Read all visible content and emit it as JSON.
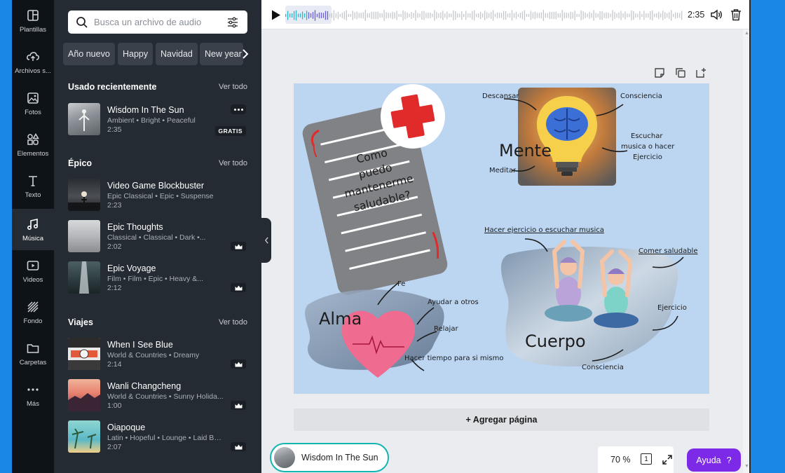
{
  "rail": {
    "items": [
      {
        "label": "Plantillas",
        "icon": "templates-icon"
      },
      {
        "label": "Archivos s...",
        "icon": "upload-cloud-icon"
      },
      {
        "label": "Fotos",
        "icon": "photo-icon"
      },
      {
        "label": "Elementos",
        "icon": "elements-icon"
      },
      {
        "label": "Texto",
        "icon": "text-icon"
      },
      {
        "label": "Música",
        "icon": "music-note-icon",
        "active": true
      },
      {
        "label": "Videos",
        "icon": "video-icon"
      },
      {
        "label": "Fondo",
        "icon": "background-pattern-icon"
      },
      {
        "label": "Carpetas",
        "icon": "folder-icon"
      },
      {
        "label": "Más",
        "icon": "more-dots-icon"
      }
    ]
  },
  "panel": {
    "search_placeholder": "Busca un archivo de audio",
    "chips": [
      "Año nuevo",
      "Happy",
      "Navidad",
      "New year"
    ],
    "sections": [
      {
        "title": "Usado recientemente",
        "link": "Ver todo",
        "tracks": [
          {
            "title": "Wisdom In The Sun",
            "meta": "Ambient • Bright • Peaceful",
            "duration": "2:35",
            "badge": "GRATIS",
            "has_more": true
          }
        ]
      },
      {
        "title": "Épico",
        "link": "Ver todo",
        "tracks": [
          {
            "title": "Video Game Blockbuster",
            "meta": "Epic Classical • Epic • Suspense",
            "duration": "2:23"
          },
          {
            "title": "Epic Thoughts",
            "meta": "Classical • Classical • Dark •...",
            "duration": "2:02",
            "premium": true
          },
          {
            "title": "Epic Voyage",
            "meta": "Film • Film • Epic • Heavy &...",
            "duration": "2:12",
            "premium": true
          }
        ]
      },
      {
        "title": "Viajes",
        "link": "Ver todo",
        "tracks": [
          {
            "title": "When I See Blue",
            "meta": "World & Countries • Dreamy",
            "duration": "2:14",
            "premium": true
          },
          {
            "title": "Wanli Changcheng",
            "meta": "World & Countries • Sunny Holida...",
            "duration": "1:00",
            "premium": true
          },
          {
            "title": "Oiapoque",
            "meta": "Latin • Hopeful • Lounge • Laid Back",
            "duration": "2:07",
            "premium": true
          }
        ]
      }
    ]
  },
  "audio_bar": {
    "time": "2:35",
    "progress": 0.11
  },
  "canvas": {
    "doc_text": [
      "Como",
      "puedo",
      "mantenerme",
      "saludable?"
    ],
    "mente": {
      "title": "Mente",
      "labels": [
        "Descansar",
        "Consciencia",
        "Escuchar",
        "musica o hacer",
        "Ejercicio",
        "Meditar"
      ]
    },
    "alma": {
      "title": "Alma",
      "labels": [
        "Fe",
        "Ayudar a otros",
        "Relajar",
        "Hacer tiempo para si mismo"
      ]
    },
    "cuerpo": {
      "title": "Cuerpo",
      "labels": [
        "Hacer ejercicio o escuchar musica",
        "Comer saludable",
        "Ejercicio",
        "Consciencia"
      ]
    }
  },
  "add_page_label": "+ Agregar página",
  "now_playing": {
    "title": "Wisdom In The Sun"
  },
  "zoom": "70 %",
  "page_count": "1",
  "help": {
    "label": "Ayuda",
    "icon_text": "?"
  },
  "colors": {
    "rail_bg": "#0e1318",
    "panel_bg": "#252b33",
    "accent": "#7d2ae8",
    "canvas_bg": "#bcd5f1",
    "frame": "#1a86e6",
    "now_playing_border": "#12b5b0"
  }
}
